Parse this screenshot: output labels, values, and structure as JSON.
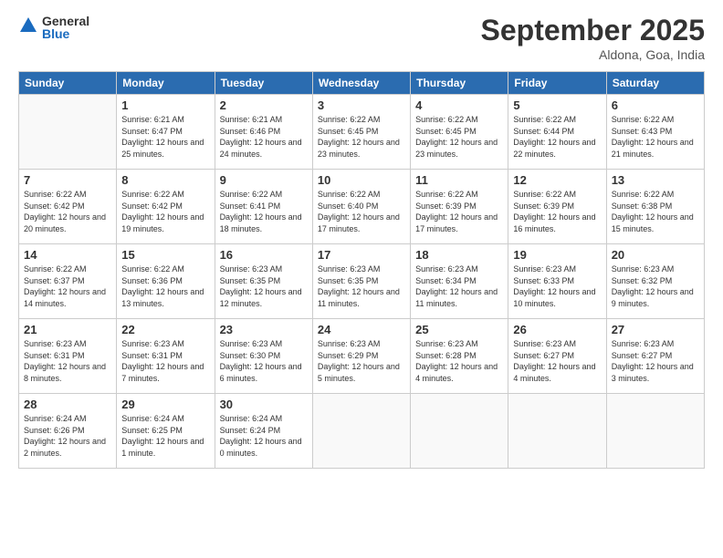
{
  "logo": {
    "general": "General",
    "blue": "Blue"
  },
  "header": {
    "month": "September 2025",
    "location": "Aldona, Goa, India"
  },
  "days": [
    "Sunday",
    "Monday",
    "Tuesday",
    "Wednesday",
    "Thursday",
    "Friday",
    "Saturday"
  ],
  "weeks": [
    [
      {
        "num": "",
        "empty": true
      },
      {
        "num": "1",
        "rise": "6:21 AM",
        "set": "6:47 PM",
        "daylight": "12 hours and 25 minutes."
      },
      {
        "num": "2",
        "rise": "6:21 AM",
        "set": "6:46 PM",
        "daylight": "12 hours and 24 minutes."
      },
      {
        "num": "3",
        "rise": "6:22 AM",
        "set": "6:45 PM",
        "daylight": "12 hours and 23 minutes."
      },
      {
        "num": "4",
        "rise": "6:22 AM",
        "set": "6:45 PM",
        "daylight": "12 hours and 23 minutes."
      },
      {
        "num": "5",
        "rise": "6:22 AM",
        "set": "6:44 PM",
        "daylight": "12 hours and 22 minutes."
      },
      {
        "num": "6",
        "rise": "6:22 AM",
        "set": "6:43 PM",
        "daylight": "12 hours and 21 minutes."
      }
    ],
    [
      {
        "num": "7",
        "rise": "6:22 AM",
        "set": "6:42 PM",
        "daylight": "12 hours and 20 minutes."
      },
      {
        "num": "8",
        "rise": "6:22 AM",
        "set": "6:42 PM",
        "daylight": "12 hours and 19 minutes."
      },
      {
        "num": "9",
        "rise": "6:22 AM",
        "set": "6:41 PM",
        "daylight": "12 hours and 18 minutes."
      },
      {
        "num": "10",
        "rise": "6:22 AM",
        "set": "6:40 PM",
        "daylight": "12 hours and 17 minutes."
      },
      {
        "num": "11",
        "rise": "6:22 AM",
        "set": "6:39 PM",
        "daylight": "12 hours and 17 minutes."
      },
      {
        "num": "12",
        "rise": "6:22 AM",
        "set": "6:39 PM",
        "daylight": "12 hours and 16 minutes."
      },
      {
        "num": "13",
        "rise": "6:22 AM",
        "set": "6:38 PM",
        "daylight": "12 hours and 15 minutes."
      }
    ],
    [
      {
        "num": "14",
        "rise": "6:22 AM",
        "set": "6:37 PM",
        "daylight": "12 hours and 14 minutes."
      },
      {
        "num": "15",
        "rise": "6:22 AM",
        "set": "6:36 PM",
        "daylight": "12 hours and 13 minutes."
      },
      {
        "num": "16",
        "rise": "6:23 AM",
        "set": "6:35 PM",
        "daylight": "12 hours and 12 minutes."
      },
      {
        "num": "17",
        "rise": "6:23 AM",
        "set": "6:35 PM",
        "daylight": "12 hours and 11 minutes."
      },
      {
        "num": "18",
        "rise": "6:23 AM",
        "set": "6:34 PM",
        "daylight": "12 hours and 11 minutes."
      },
      {
        "num": "19",
        "rise": "6:23 AM",
        "set": "6:33 PM",
        "daylight": "12 hours and 10 minutes."
      },
      {
        "num": "20",
        "rise": "6:23 AM",
        "set": "6:32 PM",
        "daylight": "12 hours and 9 minutes."
      }
    ],
    [
      {
        "num": "21",
        "rise": "6:23 AM",
        "set": "6:31 PM",
        "daylight": "12 hours and 8 minutes."
      },
      {
        "num": "22",
        "rise": "6:23 AM",
        "set": "6:31 PM",
        "daylight": "12 hours and 7 minutes."
      },
      {
        "num": "23",
        "rise": "6:23 AM",
        "set": "6:30 PM",
        "daylight": "12 hours and 6 minutes."
      },
      {
        "num": "24",
        "rise": "6:23 AM",
        "set": "6:29 PM",
        "daylight": "12 hours and 5 minutes."
      },
      {
        "num": "25",
        "rise": "6:23 AM",
        "set": "6:28 PM",
        "daylight": "12 hours and 4 minutes."
      },
      {
        "num": "26",
        "rise": "6:23 AM",
        "set": "6:27 PM",
        "daylight": "12 hours and 4 minutes."
      },
      {
        "num": "27",
        "rise": "6:23 AM",
        "set": "6:27 PM",
        "daylight": "12 hours and 3 minutes."
      }
    ],
    [
      {
        "num": "28",
        "rise": "6:24 AM",
        "set": "6:26 PM",
        "daylight": "12 hours and 2 minutes."
      },
      {
        "num": "29",
        "rise": "6:24 AM",
        "set": "6:25 PM",
        "daylight": "12 hours and 1 minute."
      },
      {
        "num": "30",
        "rise": "6:24 AM",
        "set": "6:24 PM",
        "daylight": "12 hours and 0 minutes."
      },
      {
        "num": "",
        "empty": true
      },
      {
        "num": "",
        "empty": true
      },
      {
        "num": "",
        "empty": true
      },
      {
        "num": "",
        "empty": true
      }
    ]
  ]
}
